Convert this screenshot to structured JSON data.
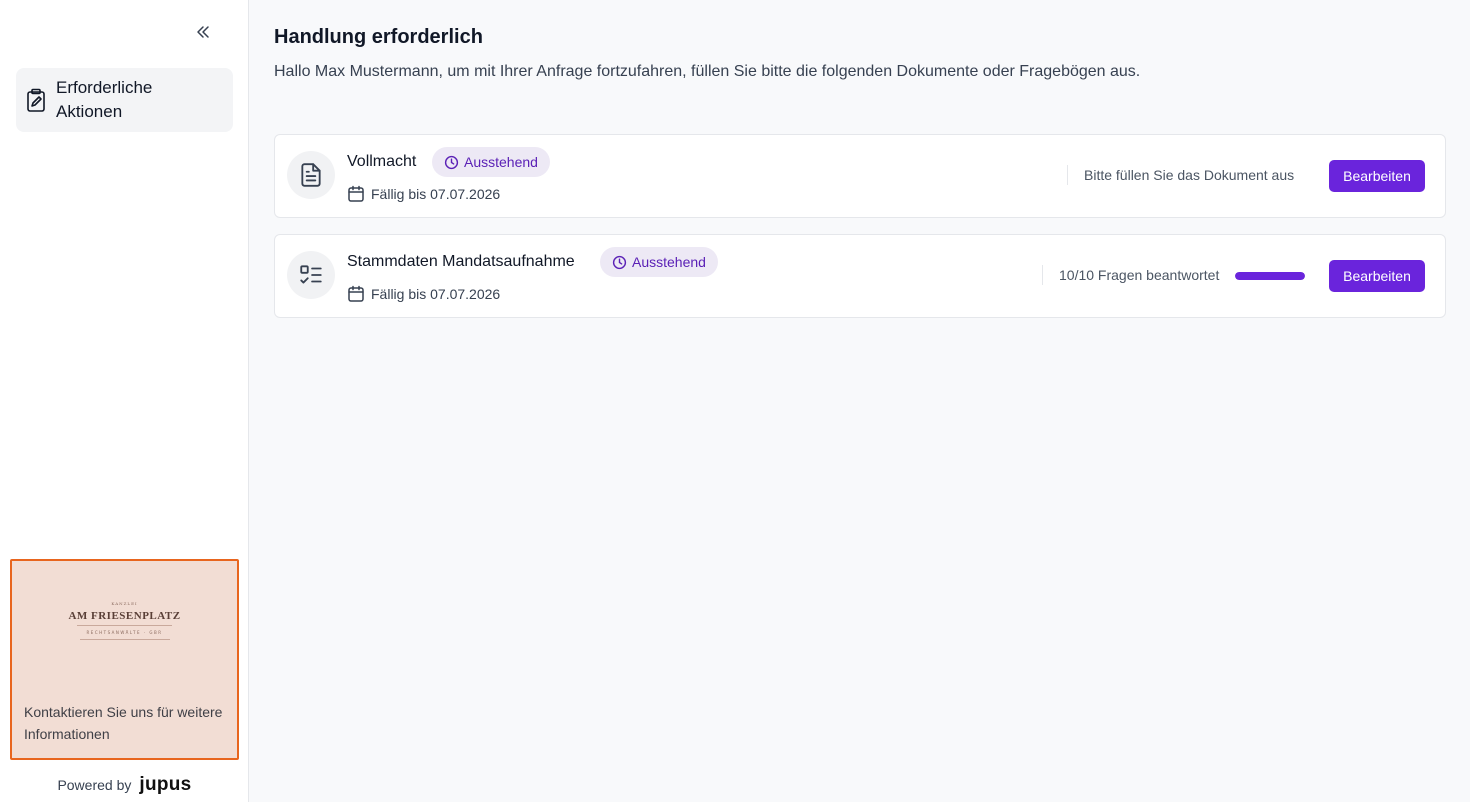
{
  "sidebar": {
    "nav_items": [
      {
        "label": "Erforderliche Aktionen",
        "icon": "clipboard-signature-icon"
      }
    ],
    "firm": {
      "logo_small_top": "KANZLEI",
      "logo_name": "AM FRIESENPLATZ",
      "logo_sub": "RECHTSANWÄLTE · GBR",
      "contact_text": "Kontaktieren Sie uns für weitere Informationen"
    },
    "powered_by": {
      "prefix": "Powered by",
      "brand": "jupus"
    }
  },
  "main": {
    "title": "Handlung erforderlich",
    "subtitle": "Hallo Max Mustermann, um mit Ihrer Anfrage fortzufahren, füllen Sie bitte die folgenden Dokumente oder Fragebögen aus.",
    "tasks": [
      {
        "title": "Vollmacht",
        "icon": "document-icon",
        "badge": "Ausstehend",
        "due": "Fällig bis 07.07.2026",
        "status": "Bitte füllen Sie das Dokument aus",
        "button": "Bearbeiten"
      },
      {
        "title": "Stammdaten Mandatsaufnahme",
        "icon": "checklist-icon",
        "badge": "Ausstehend",
        "due": "Fällig bis 07.07.2026",
        "status": "10/10 Fragen beantwortet",
        "progress": 1.0,
        "button": "Bearbeiten"
      }
    ]
  },
  "colors": {
    "accent": "#6a24dc",
    "badge_bg": "#ede9f5",
    "firm_border": "#e8651e",
    "firm_bg": "#f2ddd4"
  }
}
